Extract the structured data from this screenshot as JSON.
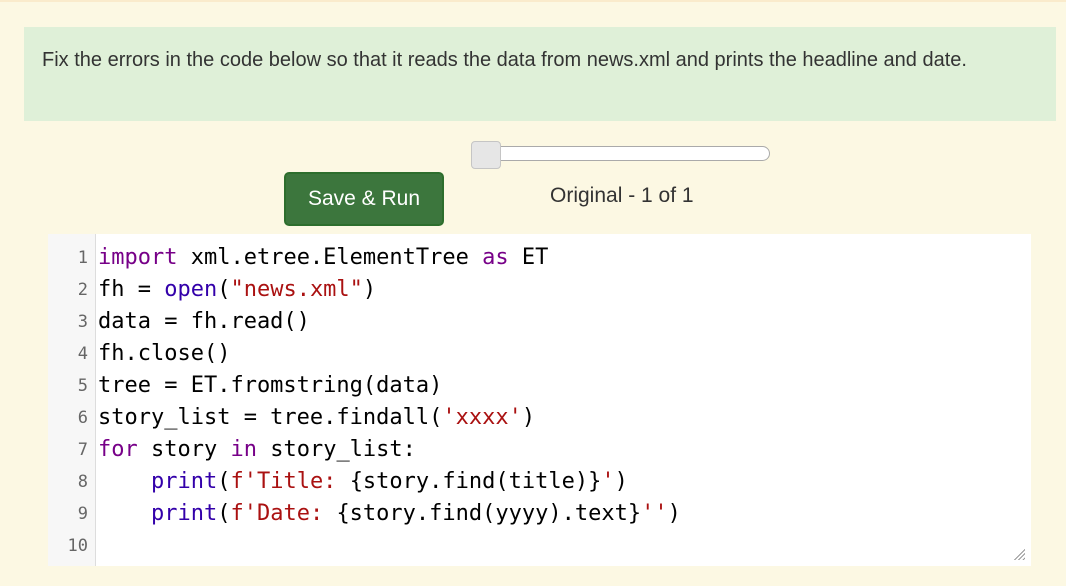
{
  "instructions": {
    "text": "Fix the errors in the code below so that it reads the data from news.xml and prints the headline and date."
  },
  "controls": {
    "run_button_label": "Save & Run",
    "scrubber_status": "Original - 1 of 1",
    "slider_value": 0
  },
  "editor": {
    "lines": [
      {
        "number": "1",
        "segments": [
          {
            "text": "import",
            "style": "kw"
          },
          {
            "text": " xml.etree.ElementTree ",
            "style": ""
          },
          {
            "text": "as",
            "style": "kw"
          },
          {
            "text": " ET",
            "style": ""
          }
        ]
      },
      {
        "number": "2",
        "segments": [
          {
            "text": "fh = ",
            "style": ""
          },
          {
            "text": "open",
            "style": "bi"
          },
          {
            "text": "(",
            "style": ""
          },
          {
            "text": "\"news.xml\"",
            "style": "str"
          },
          {
            "text": ")",
            "style": ""
          }
        ]
      },
      {
        "number": "3",
        "segments": [
          {
            "text": "data = fh.read()",
            "style": ""
          }
        ]
      },
      {
        "number": "4",
        "segments": [
          {
            "text": "fh.close()",
            "style": ""
          }
        ]
      },
      {
        "number": "5",
        "segments": [
          {
            "text": "tree = ET.fromstring(data)",
            "style": ""
          }
        ]
      },
      {
        "number": "6",
        "segments": [
          {
            "text": "story_list = tree.findall(",
            "style": ""
          },
          {
            "text": "'xxxx'",
            "style": "str"
          },
          {
            "text": ")",
            "style": ""
          }
        ]
      },
      {
        "number": "7",
        "segments": [
          {
            "text": "for",
            "style": "kw"
          },
          {
            "text": " story ",
            "style": ""
          },
          {
            "text": "in",
            "style": "kw"
          },
          {
            "text": " story_list:",
            "style": ""
          }
        ]
      },
      {
        "number": "8",
        "segments": [
          {
            "text": "    ",
            "style": ""
          },
          {
            "text": "print",
            "style": "bi"
          },
          {
            "text": "(",
            "style": ""
          },
          {
            "text": "f'Title: ",
            "style": "str"
          },
          {
            "text": "{story.find(title)}",
            "style": ""
          },
          {
            "text": "'",
            "style": "str"
          },
          {
            "text": ")",
            "style": ""
          }
        ]
      },
      {
        "number": "9",
        "segments": [
          {
            "text": "    ",
            "style": ""
          },
          {
            "text": "print",
            "style": "bi"
          },
          {
            "text": "(",
            "style": ""
          },
          {
            "text": "f'Date: ",
            "style": "str"
          },
          {
            "text": "{story.find(yyyy).text}",
            "style": ""
          },
          {
            "text": "''",
            "style": "str"
          },
          {
            "text": ")",
            "style": ""
          }
        ]
      },
      {
        "number": "10",
        "segments": [
          {
            "text": "",
            "style": ""
          }
        ]
      }
    ]
  }
}
